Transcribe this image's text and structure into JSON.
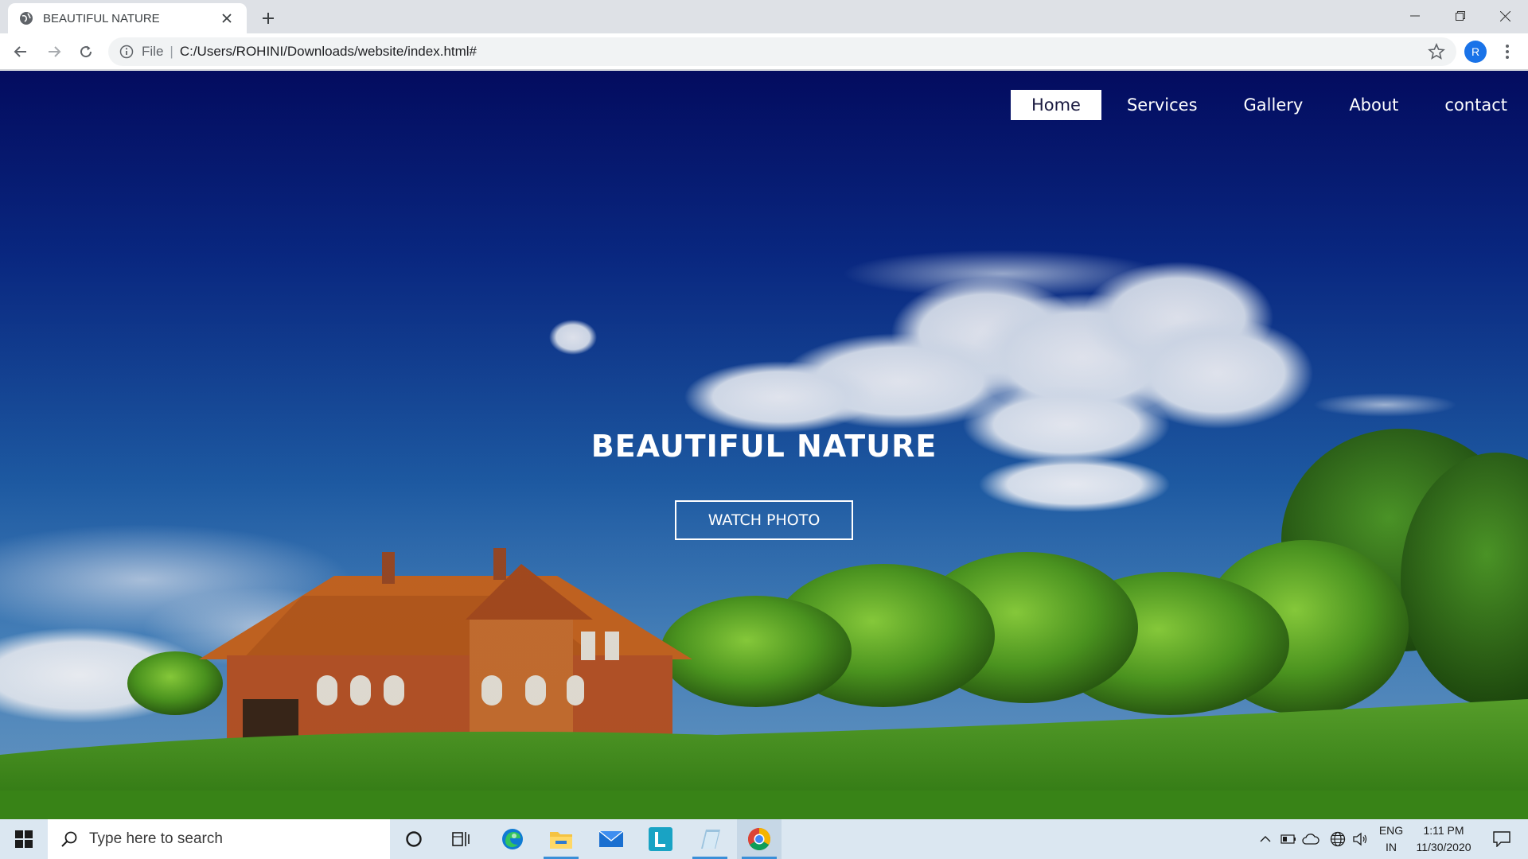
{
  "browser": {
    "tab_title": "BEAUTIFUL NATURE",
    "omnibox": {
      "scheme_label": "File",
      "separator": "|",
      "url": "C:/Users/ROHINI/Downloads/website/index.html#"
    },
    "profile_initial": "R"
  },
  "site": {
    "nav": [
      {
        "label": "Home",
        "active": true
      },
      {
        "label": "Services",
        "active": false
      },
      {
        "label": "Gallery",
        "active": false
      },
      {
        "label": "About",
        "active": false
      },
      {
        "label": "contact",
        "active": false
      }
    ],
    "hero_title": "BEAUTIFUL NATURE",
    "hero_button": "WATCH PHOTO"
  },
  "taskbar": {
    "search_placeholder": "Type here to search",
    "pinned": [
      "cortana-icon",
      "task-view-icon",
      "edge-icon",
      "file-explorer-icon",
      "mail-icon",
      "l-app-icon",
      "notes-app-icon",
      "chrome-icon"
    ],
    "tray": {
      "lang_line1": "ENG",
      "lang_line2": "IN",
      "time": "1:11 PM",
      "date": "11/30/2020"
    }
  },
  "colors": {
    "sky_top": "#06106e",
    "sky_mid": "#1f5fa6",
    "grass": "#3f8a1a",
    "taskbar": "#dbe7f1",
    "accent_blue": "#1a73e8"
  }
}
